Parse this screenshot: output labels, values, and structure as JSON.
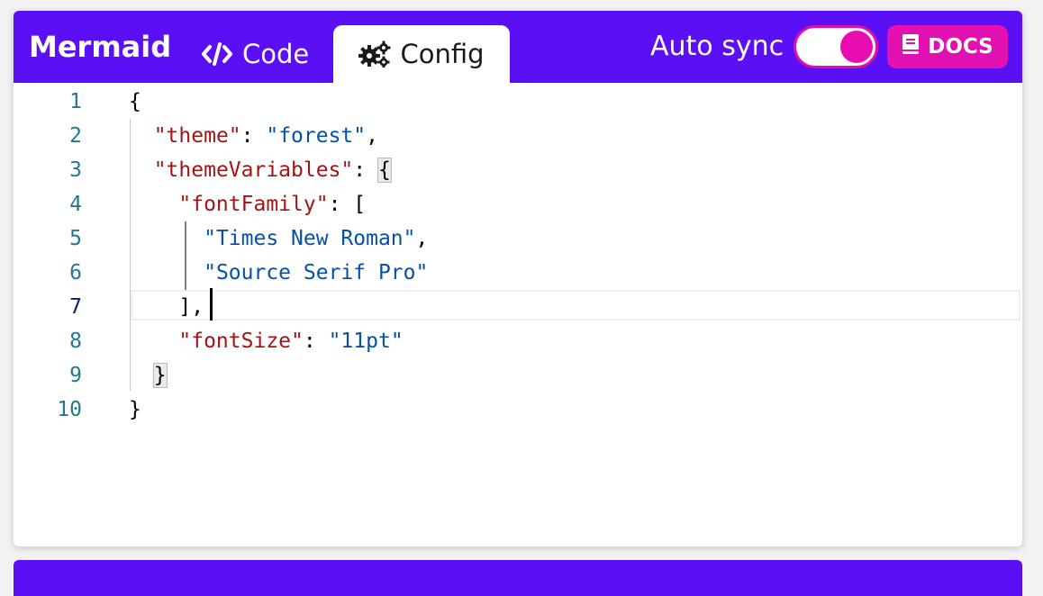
{
  "header": {
    "title": "Mermaid",
    "tabs": [
      {
        "label": "Code",
        "icon": "code-icon",
        "active": false
      },
      {
        "label": "Config",
        "icon": "gears-icon",
        "active": true
      }
    ],
    "auto_sync": {
      "label": "Auto sync",
      "enabled": true
    },
    "docs_button": {
      "label": "DOCS",
      "icon": "book-icon"
    }
  },
  "colors": {
    "header_bg": "#5a0ff5",
    "accent": "#e20fb1",
    "json_key": "#a31515",
    "json_string": "#0451a5",
    "line_number": "#237893"
  },
  "editor": {
    "active_line": 7,
    "line_numbers": [
      "1",
      "2",
      "3",
      "4",
      "5",
      "6",
      "7",
      "8",
      "9",
      "10"
    ],
    "lines": [
      [
        {
          "t": "p",
          "v": "{"
        }
      ],
      [
        {
          "t": "p",
          "v": "  "
        },
        {
          "t": "k",
          "v": "\"theme\""
        },
        {
          "t": "p",
          "v": ": "
        },
        {
          "t": "s",
          "v": "\"forest\""
        },
        {
          "t": "p",
          "v": ","
        }
      ],
      [
        {
          "t": "p",
          "v": "  "
        },
        {
          "t": "k",
          "v": "\"themeVariables\""
        },
        {
          "t": "p",
          "v": ": "
        },
        {
          "t": "bm",
          "v": "{"
        }
      ],
      [
        {
          "t": "p",
          "v": "    "
        },
        {
          "t": "k",
          "v": "\"fontFamily\""
        },
        {
          "t": "p",
          "v": ": ["
        }
      ],
      [
        {
          "t": "p",
          "v": "      "
        },
        {
          "t": "s",
          "v": "\"Times New Roman\""
        },
        {
          "t": "p",
          "v": ","
        }
      ],
      [
        {
          "t": "p",
          "v": "      "
        },
        {
          "t": "s",
          "v": "\"Source Serif Pro\""
        }
      ],
      [
        {
          "t": "p",
          "v": "    ],"
        }
      ],
      [
        {
          "t": "p",
          "v": "    "
        },
        {
          "t": "k",
          "v": "\"fontSize\""
        },
        {
          "t": "p",
          "v": ": "
        },
        {
          "t": "s",
          "v": "\"11pt\""
        }
      ],
      [
        {
          "t": "p",
          "v": "  "
        },
        {
          "t": "bm",
          "v": "}"
        }
      ],
      [
        {
          "t": "p",
          "v": "}"
        }
      ]
    ]
  }
}
